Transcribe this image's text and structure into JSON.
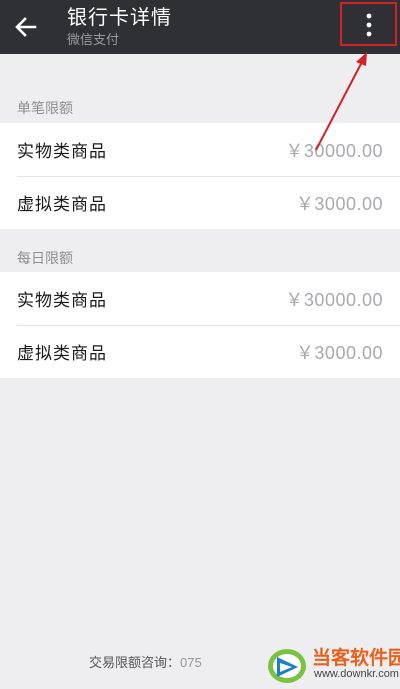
{
  "header": {
    "title": "银行卡详情",
    "subtitle": "微信支付"
  },
  "sections": [
    {
      "title": "单笔限额",
      "rows": [
        {
          "label": "实物类商品",
          "value": "￥30000.00"
        },
        {
          "label": "虚拟类商品",
          "value": "￥3000.00"
        }
      ]
    },
    {
      "title": "每日限额",
      "rows": [
        {
          "label": "实物类商品",
          "value": "￥30000.00"
        },
        {
          "label": "虚拟类商品",
          "value": "￥3000.00"
        }
      ]
    }
  ],
  "footer": {
    "label": "交易限额咨询：",
    "phone": "075"
  },
  "watermark": {
    "name": "当客软件园",
    "url": "www.downkr.com"
  },
  "colors": {
    "topbar": "#2e3035",
    "highlight": "#d42027",
    "watermark": "#e8611c"
  }
}
